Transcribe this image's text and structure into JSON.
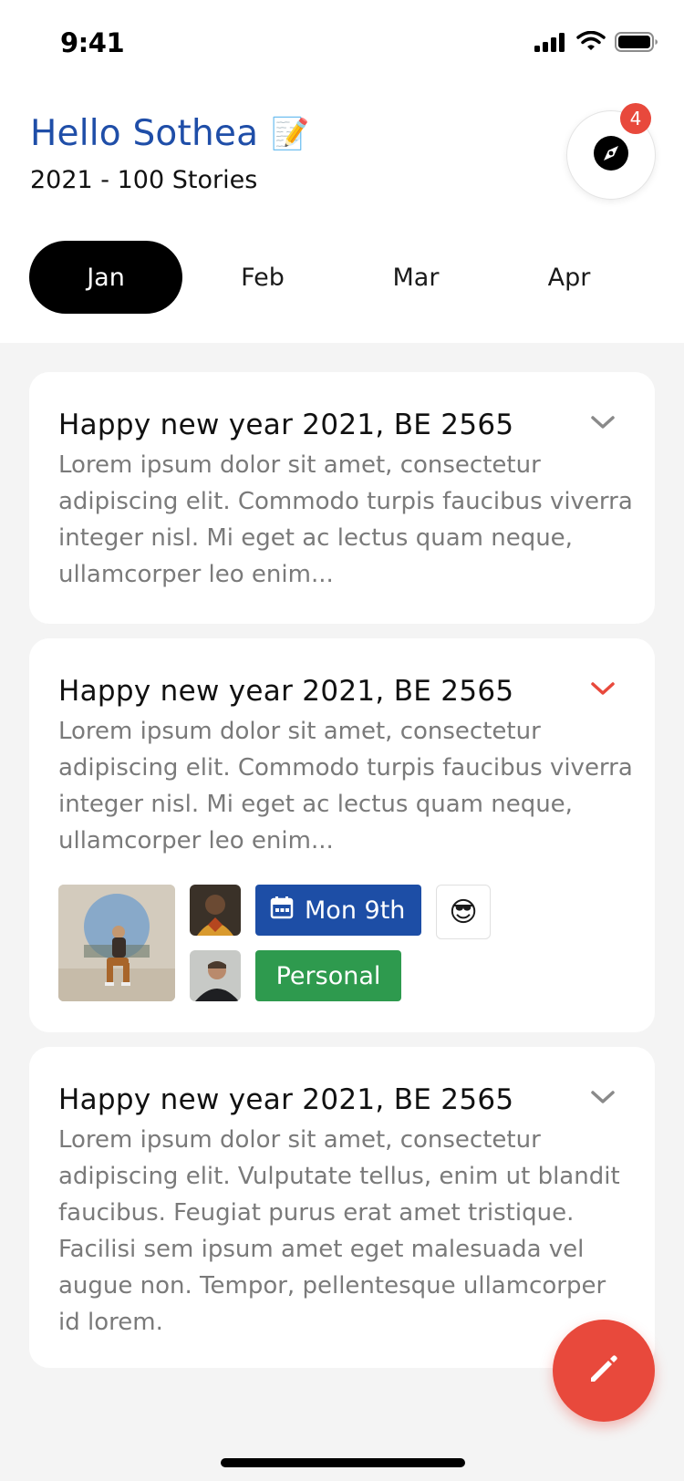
{
  "status_bar": {
    "time": "9:41"
  },
  "header": {
    "greeting": "Hello Sothea",
    "greeting_emoji": "📝",
    "subtitle": "2021 - 100 Stories",
    "explore_icon": "compass-icon",
    "notification_count": "4"
  },
  "tabs": [
    {
      "label": "Jan",
      "active": true
    },
    {
      "label": "Feb",
      "active": false
    },
    {
      "label": "Mar",
      "active": false
    },
    {
      "label": "Apr",
      "active": false
    }
  ],
  "stories": [
    {
      "title": "Happy new year 2021, BE 2565",
      "body": "Lorem ipsum dolor sit amet, consectetur adipiscing elit. Commodo turpis faucibus viverra integer nisl. Mi eget ac lectus quam neque, ullamcorper leo enim...",
      "expanded": false
    },
    {
      "title": "Happy new year 2021, BE 2565",
      "body": "Lorem ipsum dolor sit amet, consectetur adipiscing elit. Commodo turpis faucibus viverra integer nisl. Mi eget ac lectus quam neque, ullamcorper leo enim...",
      "expanded": true,
      "date_label": "Mon 9th",
      "mood_emoji": "😎",
      "tag": "Personal"
    },
    {
      "title": "Happy new year 2021, BE 2565",
      "body": "Lorem ipsum dolor sit amet, consectetur adipiscing elit. Vulputate tellus, enim ut blandit faucibus. Feugiat purus erat amet tristique. Facilisi sem ipsum amet eget malesuada vel augue non. Tempor, pellentesque ullamcorper id lorem.",
      "expanded": false
    }
  ],
  "fab_icon": "pencil-icon",
  "colors": {
    "brand_blue": "#1f4ea8",
    "accent_red": "#e8493c",
    "tag_green": "#2e9a4e",
    "date_chip_blue": "#1d4ea6"
  }
}
